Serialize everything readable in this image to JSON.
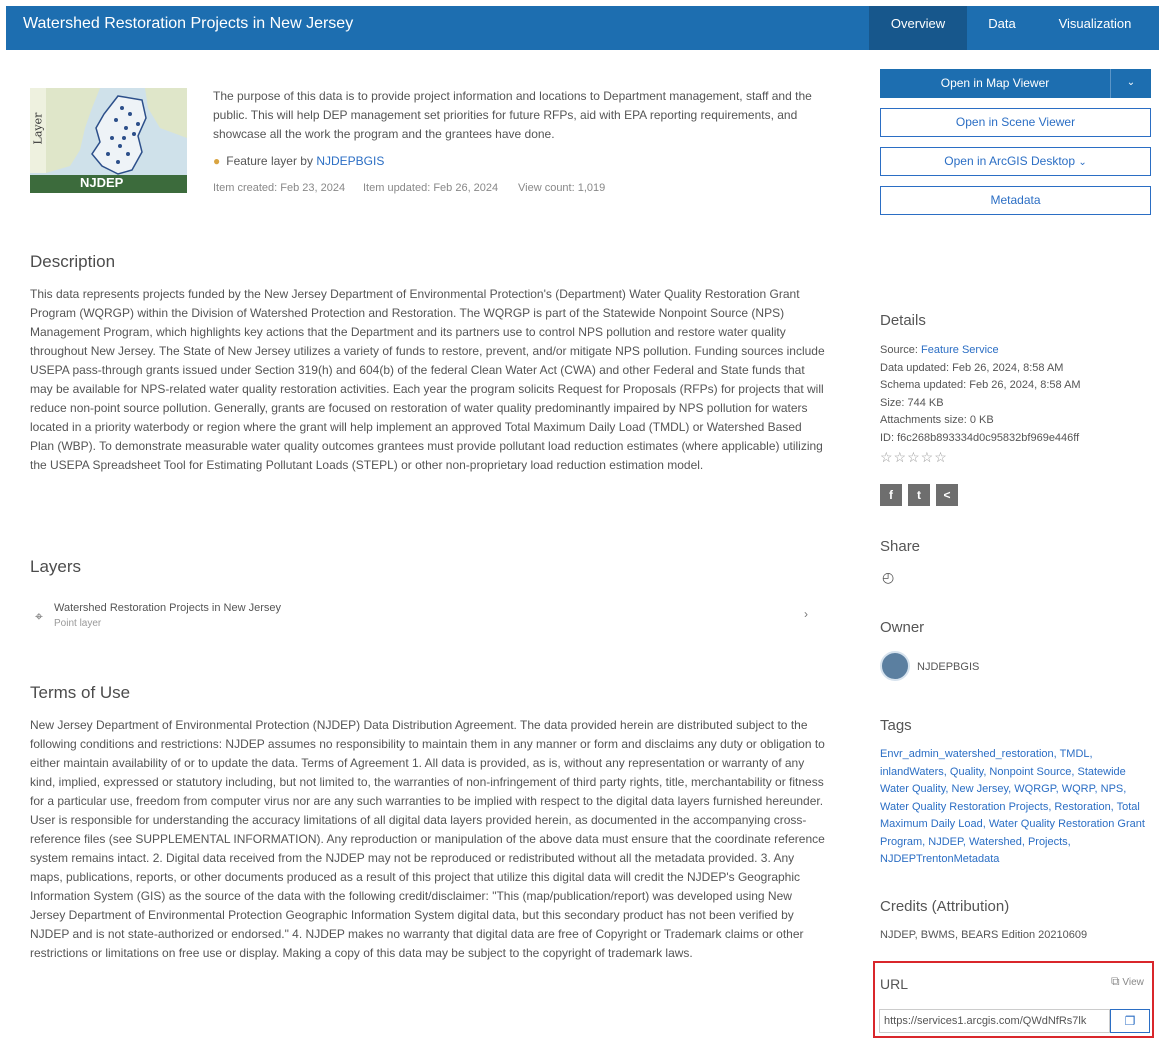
{
  "header": {
    "title": "Watershed Restoration Projects in New Jersey",
    "tabs": [
      "Overview",
      "Data",
      "Visualization"
    ],
    "active_tab": "Overview"
  },
  "thumbnail": {
    "side_label": "Layer",
    "brand": "NJDEP"
  },
  "summary": {
    "text": "The purpose of this data is to provide project information and locations to Department management, staff and the public. This will help DEP management set priorities for future RFPs, aid with EPA reporting requirements, and showcase all the work the program and the grantees have done.",
    "type_prefix": "Feature layer by",
    "owner_link": "NJDEPBGIS",
    "created": "Item created: Feb 23, 2024",
    "updated": "Item updated: Feb 26, 2024",
    "views": "View count: 1,019"
  },
  "actions": {
    "open_map_viewer": "Open in Map Viewer",
    "open_scene_viewer": "Open in Scene Viewer",
    "open_arcgis_desktop": "Open in ArcGIS Desktop",
    "metadata": "Metadata"
  },
  "description": {
    "heading": "Description",
    "text": "This data represents projects funded by the New Jersey Department of Environmental Protection's (Department) Water Quality Restoration Grant Program (WQRGP) within the Division of Watershed Protection and Restoration. The WQRGP is part of the Statewide Nonpoint Source (NPS) Management Program, which highlights key actions that the Department and its partners use to control NPS pollution and restore water quality throughout New Jersey. The State of New Jersey utilizes a variety of funds to restore, prevent, and/or mitigate NPS pollution. Funding sources include USEPA pass-through grants issued under Section 319(h) and 604(b) of the federal Clean Water Act (CWA) and other Federal and State funds that may be available for NPS-related water quality restoration activities. Each year the program solicits Request for Proposals (RFPs) for projects that will reduce non-point source pollution. Generally, grants are focused on restoration of water quality predominantly impaired by NPS pollution for waters located in a priority waterbody or region where the grant will help implement an approved Total Maximum Daily Load (TMDL) or Watershed Based Plan (WBP). To demonstrate measurable water quality outcomes grantees must provide pollutant load reduction estimates (where applicable) utilizing the USEPA Spreadsheet Tool for Estimating Pollutant Loads (STEPL) or other non-proprietary load reduction estimation model."
  },
  "layers": {
    "heading": "Layers",
    "items": [
      {
        "name": "Watershed Restoration Projects in New Jersey",
        "type": "Point layer"
      }
    ]
  },
  "terms": {
    "heading": "Terms of Use",
    "text": "New Jersey Department of Environmental Protection (NJDEP) Data Distribution Agreement. The data provided herein are distributed subject to the following conditions and restrictions: NJDEP assumes no responsibility to maintain them in any manner or form and disclaims any duty or obligation to either maintain availability of or to update the data. Terms of Agreement 1. All data is provided, as is, without any representation or warranty of any kind, implied, expressed or statutory including, but not limited to, the warranties of non-infringement of third party rights, title, merchantability or fitness for a particular use, freedom from computer virus nor are any such warranties to be implied with respect to the digital data layers furnished hereunder. User is responsible for understanding the accuracy limitations of all digital data layers provided herein, as documented in the accompanying cross-reference files (see SUPPLEMENTAL INFORMATION). Any reproduction or manipulation of the above data must ensure that the coordinate reference system remains intact. 2. Digital data received from the NJDEP may not be reproduced or redistributed without all the metadata provided. 3. Any maps, publications, reports, or other documents produced as a result of this project that utilize this digital data will credit the NJDEP's Geographic Information System (GIS) as the source of the data with the following credit/disclaimer: \"This (map/publication/report) was developed using New Jersey Department of Environmental Protection Geographic Information System digital data, but this secondary product has not been verified by NJDEP and is not state-authorized or endorsed.\" 4. NJDEP makes no warranty that digital data are free of Copyright or Trademark claims or other restrictions or limitations on free use or display. Making a copy of this data may be subject to the copyright of trademark laws."
  },
  "details": {
    "heading": "Details",
    "source_label": "Source:",
    "source_value": "Feature Service",
    "data_updated": "Data updated: Feb 26, 2024, 8:58 AM",
    "schema_updated": "Schema updated: Feb 26, 2024, 8:58 AM",
    "size": "Size: 744 KB",
    "attachments_size": "Attachments size: 0 KB",
    "id": "ID: f6c268b893334d0c95832bf969e446ff",
    "rating_stars": "☆☆☆☆☆"
  },
  "social": {
    "facebook": "f",
    "twitter": "t",
    "share": "<"
  },
  "share": {
    "heading": "Share",
    "icon": "public-globe-icon"
  },
  "owner": {
    "heading": "Owner",
    "name": "NJDEPBGIS"
  },
  "tags": {
    "heading": "Tags",
    "text": "Envr_admin_watershed_restoration, TMDL, inlandWaters, Quality, Nonpoint Source, Statewide Water Quality, New Jersey, WQRGP, WQRP, NPS, Water Quality Restoration Projects, Restoration, Total Maximum Daily Load, Water Quality Restoration Grant Program, NJDEP, Watershed, Projects, NJDEPTrentonMetadata"
  },
  "credits": {
    "heading": "Credits (Attribution)",
    "text": "NJDEP, BWMS, BEARS Edition 20210609"
  },
  "url": {
    "label": "URL",
    "view_label": "View",
    "value": "https://services1.arcgis.com/QWdNfRs7lk"
  },
  "colors": {
    "brand_blue": "#1d6eb0",
    "active_tab": "#17578c",
    "link": "#2b6ec4",
    "highlight": "#d9262b"
  }
}
